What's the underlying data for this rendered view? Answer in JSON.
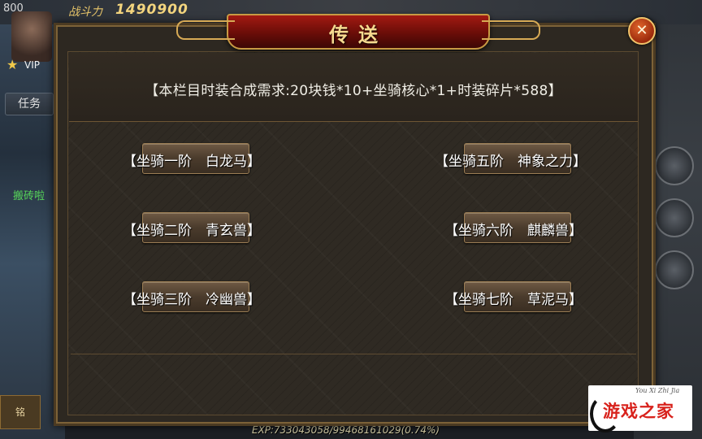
{
  "hud": {
    "level": "800",
    "combat_label": "战斗力",
    "combat_value": "1490900",
    "vip_label": "VIP",
    "task_label": "任务",
    "green_text": "搬砖啦",
    "bottom_left_label": "铭",
    "exp_text": "EXP:733043058/99468161029(0.74%)"
  },
  "dialog": {
    "title": "传送",
    "close_glyph": "✕",
    "requirement": "【本栏目时装合成需求:20块钱*10+坐骑核心*1+时装碎片*588】"
  },
  "mounts": {
    "left": [
      {
        "label": "【坐骑一阶　白龙马】"
      },
      {
        "label": "【坐骑二阶　青玄兽】"
      },
      {
        "label": "【坐骑三阶　冷幽兽】"
      }
    ],
    "right": [
      {
        "label": "【坐骑五阶　神象之力】"
      },
      {
        "label": "【坐骑六阶　麒麟兽】"
      },
      {
        "label": "【坐骑七阶　草泥马】"
      }
    ]
  },
  "watermark": {
    "logo_text": "游戏之家",
    "logo_script": "You Xi Zhi Jia"
  },
  "colors": {
    "title_red": "#a21a12",
    "gold_trim": "#c89a44",
    "panel_brown": "#2f2a23",
    "text_white": "#f1efe7"
  }
}
